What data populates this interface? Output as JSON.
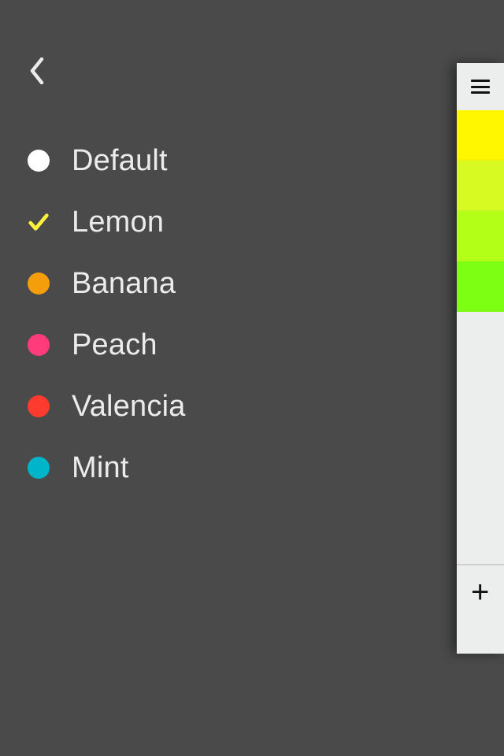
{
  "selected_theme": "Lemon",
  "themes": [
    {
      "id": "default",
      "label": "Default",
      "color": "#ffffff"
    },
    {
      "id": "lemon",
      "label": "Lemon",
      "color": "#fff33a"
    },
    {
      "id": "banana",
      "label": "Banana",
      "color": "#f59e0b"
    },
    {
      "id": "peach",
      "label": "Peach",
      "color": "#ff3b7b"
    },
    {
      "id": "valencia",
      "label": "Valencia",
      "color": "#ff3b30"
    },
    {
      "id": "mint",
      "label": "Mint",
      "color": "#00b5c9"
    }
  ],
  "reveal": {
    "gradient": [
      "#fff700",
      "#d7fa22",
      "#b4ff17",
      "#7dff13"
    ],
    "add_label": "+"
  }
}
